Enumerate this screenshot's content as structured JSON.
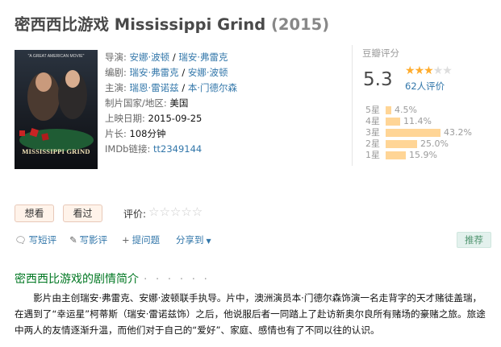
{
  "header": {
    "title": "密西西比游戏 Mississippi Grind",
    "year": "(2015)"
  },
  "poster": {
    "top_caption": "\"A GREAT AMERICAN MOVIE\"",
    "title": "MISSISSIPPI GRIND"
  },
  "info": {
    "director": {
      "label": "导演:",
      "names": [
        "安娜·波顿",
        "瑞安·弗雷克"
      ]
    },
    "writer": {
      "label": "编剧:",
      "names": [
        "瑞安·弗雷克",
        "安娜·波顿"
      ]
    },
    "cast": {
      "label": "主演:",
      "names": [
        "瑞恩·雷诺兹",
        "本·门德尔森"
      ]
    },
    "country": {
      "label": "制片国家/地区:",
      "value": "美国"
    },
    "release": {
      "label": "上映日期:",
      "value": "2015-09-25"
    },
    "runtime": {
      "label": "片长:",
      "value": "108分钟"
    },
    "imdb": {
      "label": "IMDb链接:",
      "value": "tt2349144"
    },
    "separator": " / "
  },
  "rating": {
    "label": "豆瓣评分",
    "score": "5.3",
    "stars_filled": 3,
    "votes": "62人评价",
    "distribution": [
      {
        "label": "5星",
        "pct": "4.5%",
        "value": 4.5
      },
      {
        "label": "4星",
        "pct": "11.4%",
        "value": 11.4
      },
      {
        "label": "3星",
        "pct": "43.2%",
        "value": 43.2
      },
      {
        "label": "2星",
        "pct": "25.0%",
        "value": 25.0
      },
      {
        "label": "1星",
        "pct": "15.9%",
        "value": 15.9
      }
    ]
  },
  "interest": {
    "want": "想看",
    "seen": "看过",
    "rate_label": "评价:",
    "rate_stars": "☆☆☆☆☆"
  },
  "actions": {
    "review": "写短评",
    "long_review": "写影评",
    "question": "提问题",
    "share": "分享到",
    "share_arrow": "▼",
    "recommend": "推荐"
  },
  "synopsis": {
    "heading": "密西西比游戏的剧情简介",
    "dots": "· · · · · ·",
    "text": "影片由主创瑞安·弗雷克、安娜·波顿联手执导。片中，澳洲演员本·门德尔森饰演一名走背字的天才赌徒盖瑞，在遇到了“幸运星”柯蒂斯（瑞安·雷诺兹饰）之后，他说服后者一同踏上了赴访新奥尔良所有赌场的豪赌之旅。旅途中两人的友情逐渐升温，而他们对于自己的“爱好”、家庭、感情也有了不同以往的认识。"
  },
  "colors": {
    "link": "#3377aa",
    "star": "#ffac2d",
    "bar": "#ffd596",
    "heading_green": "#007722"
  }
}
